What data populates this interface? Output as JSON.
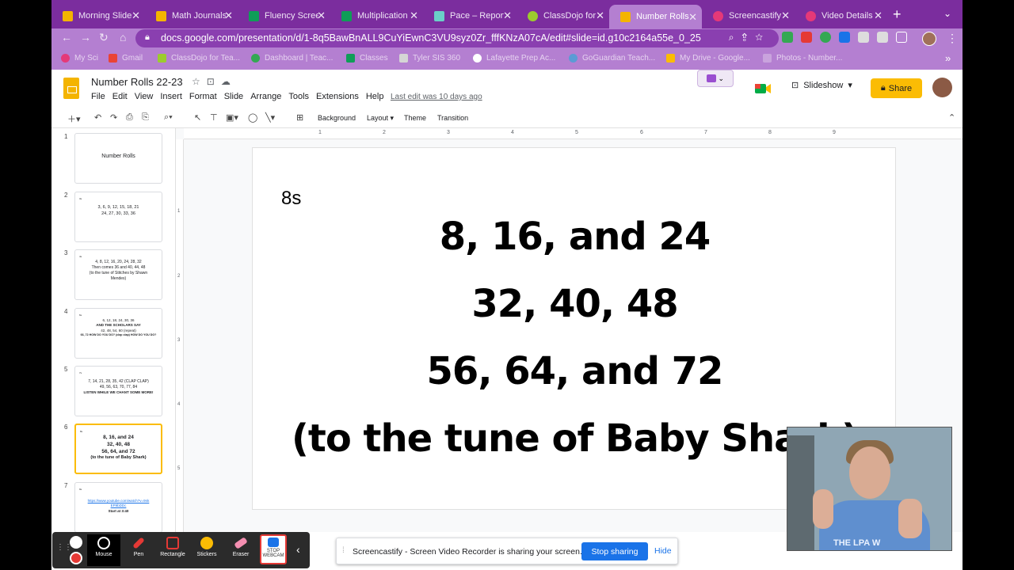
{
  "browser": {
    "tabs": [
      {
        "label": "Morning Slides",
        "color": "#f4b400"
      },
      {
        "label": "Math Journals",
        "color": "#f4b400"
      },
      {
        "label": "Fluency Screen",
        "color": "#0f9d58"
      },
      {
        "label": "Multiplication",
        "color": "#0f9d58"
      },
      {
        "label": "Pace – Report",
        "color": "#ffffff"
      },
      {
        "label": "ClassDojo for",
        "color": "#9ccc2e"
      },
      {
        "label": "Number Rolls",
        "color": "#f4b400",
        "active": true
      },
      {
        "label": "Screencastify",
        "color": "#e53978"
      },
      {
        "label": "Video Details",
        "color": "#e53935"
      }
    ],
    "url": "docs.google.com/presentation/d/1-8q5BawBnALL9CuYiEwnC3VU9syz0Zr_fffKNzA07cA/edit#slide=id.g10c2164a55e_0_25",
    "bookmarks": [
      "My Sci",
      "Gmail",
      "ClassDojo for Tea...",
      "Dashboard | Teac...",
      "Classes",
      "Tyler SIS 360",
      "Lafayette Prep Ac...",
      "GoGuardian Teach...",
      "My Drive - Google...",
      "Photos - Number..."
    ]
  },
  "doc": {
    "title": "Number Rolls 22-23",
    "menu": [
      "File",
      "Edit",
      "View",
      "Insert",
      "Format",
      "Slide",
      "Arrange",
      "Tools",
      "Extensions",
      "Help"
    ],
    "last_edit": "Last edit was 10 days ago",
    "slideshow_label": "Slideshow",
    "share_label": "Share"
  },
  "toolbar": {
    "background": "Background",
    "layout": "Layout",
    "theme": "Theme",
    "transition": "Transition"
  },
  "ruler": {
    "h": [
      "1",
      "2",
      "3",
      "4",
      "5",
      "6",
      "7",
      "8",
      "9"
    ],
    "v": [
      "1",
      "2",
      "3",
      "4",
      "5"
    ]
  },
  "thumbnails": [
    {
      "num": "1",
      "lines": [
        "Number Rolls"
      ]
    },
    {
      "num": "2",
      "corner": "3s",
      "lines": [
        "3, 6, 9, 12, 15, 18, 21",
        "24, 27, 30, 33, 36"
      ]
    },
    {
      "num": "3",
      "corner": "4s",
      "lines": [
        "4, 8, 12, 16, 20, 24, 28, 32",
        "Then comes 36 and 40, 44, 48",
        "(to the tune of Stitches by Shawn",
        "Mendes)"
      ]
    },
    {
      "num": "4",
      "corner": "6s",
      "lines": [
        "6, 12, 18, 24, 30, 36",
        "AND THE SCHOLARS SAY",
        "42, 48, 54, 60 (repeat)",
        "66, 72 HOW DO YOU DO? (clap clap) HOW DO YOU DO?"
      ]
    },
    {
      "num": "5",
      "corner": "7s",
      "lines": [
        "7, 14, 21, 28, 35, 42 (CLAP CLAP)",
        "49, 56, 63, 70, 77, 84",
        "LISTEN WHILE WE CHANT SOME MORE!"
      ]
    },
    {
      "num": "6",
      "corner": "8s",
      "lines": [
        "8, 16, and 24",
        "32, 40, 48",
        "56, 64, and 72",
        "(to the tune of Baby Shark)"
      ],
      "selected": true
    },
    {
      "num": "7",
      "corner": "9s",
      "lines": [
        "https://www.youtube.com/watch?v=9nk",
        "EP9bDDc",
        "Start at 3:40"
      ]
    }
  ],
  "slide": {
    "label": "8s",
    "lines": [
      "8, 16, and 24",
      "32, 40, 48",
      "56, 64, and 72",
      "(to the tune of Baby Shark)"
    ]
  },
  "screencastify": {
    "tools": [
      "Mouse",
      "Pen",
      "Rectangle",
      "Stickers",
      "Eraser",
      "STOP WEBCAM"
    ],
    "banner_message": "Screencastify - Screen Video Recorder is sharing your screen.",
    "stop_sharing": "Stop sharing",
    "hide": "Hide"
  },
  "webcam": {
    "shirt_text": "THE LPA W"
  }
}
